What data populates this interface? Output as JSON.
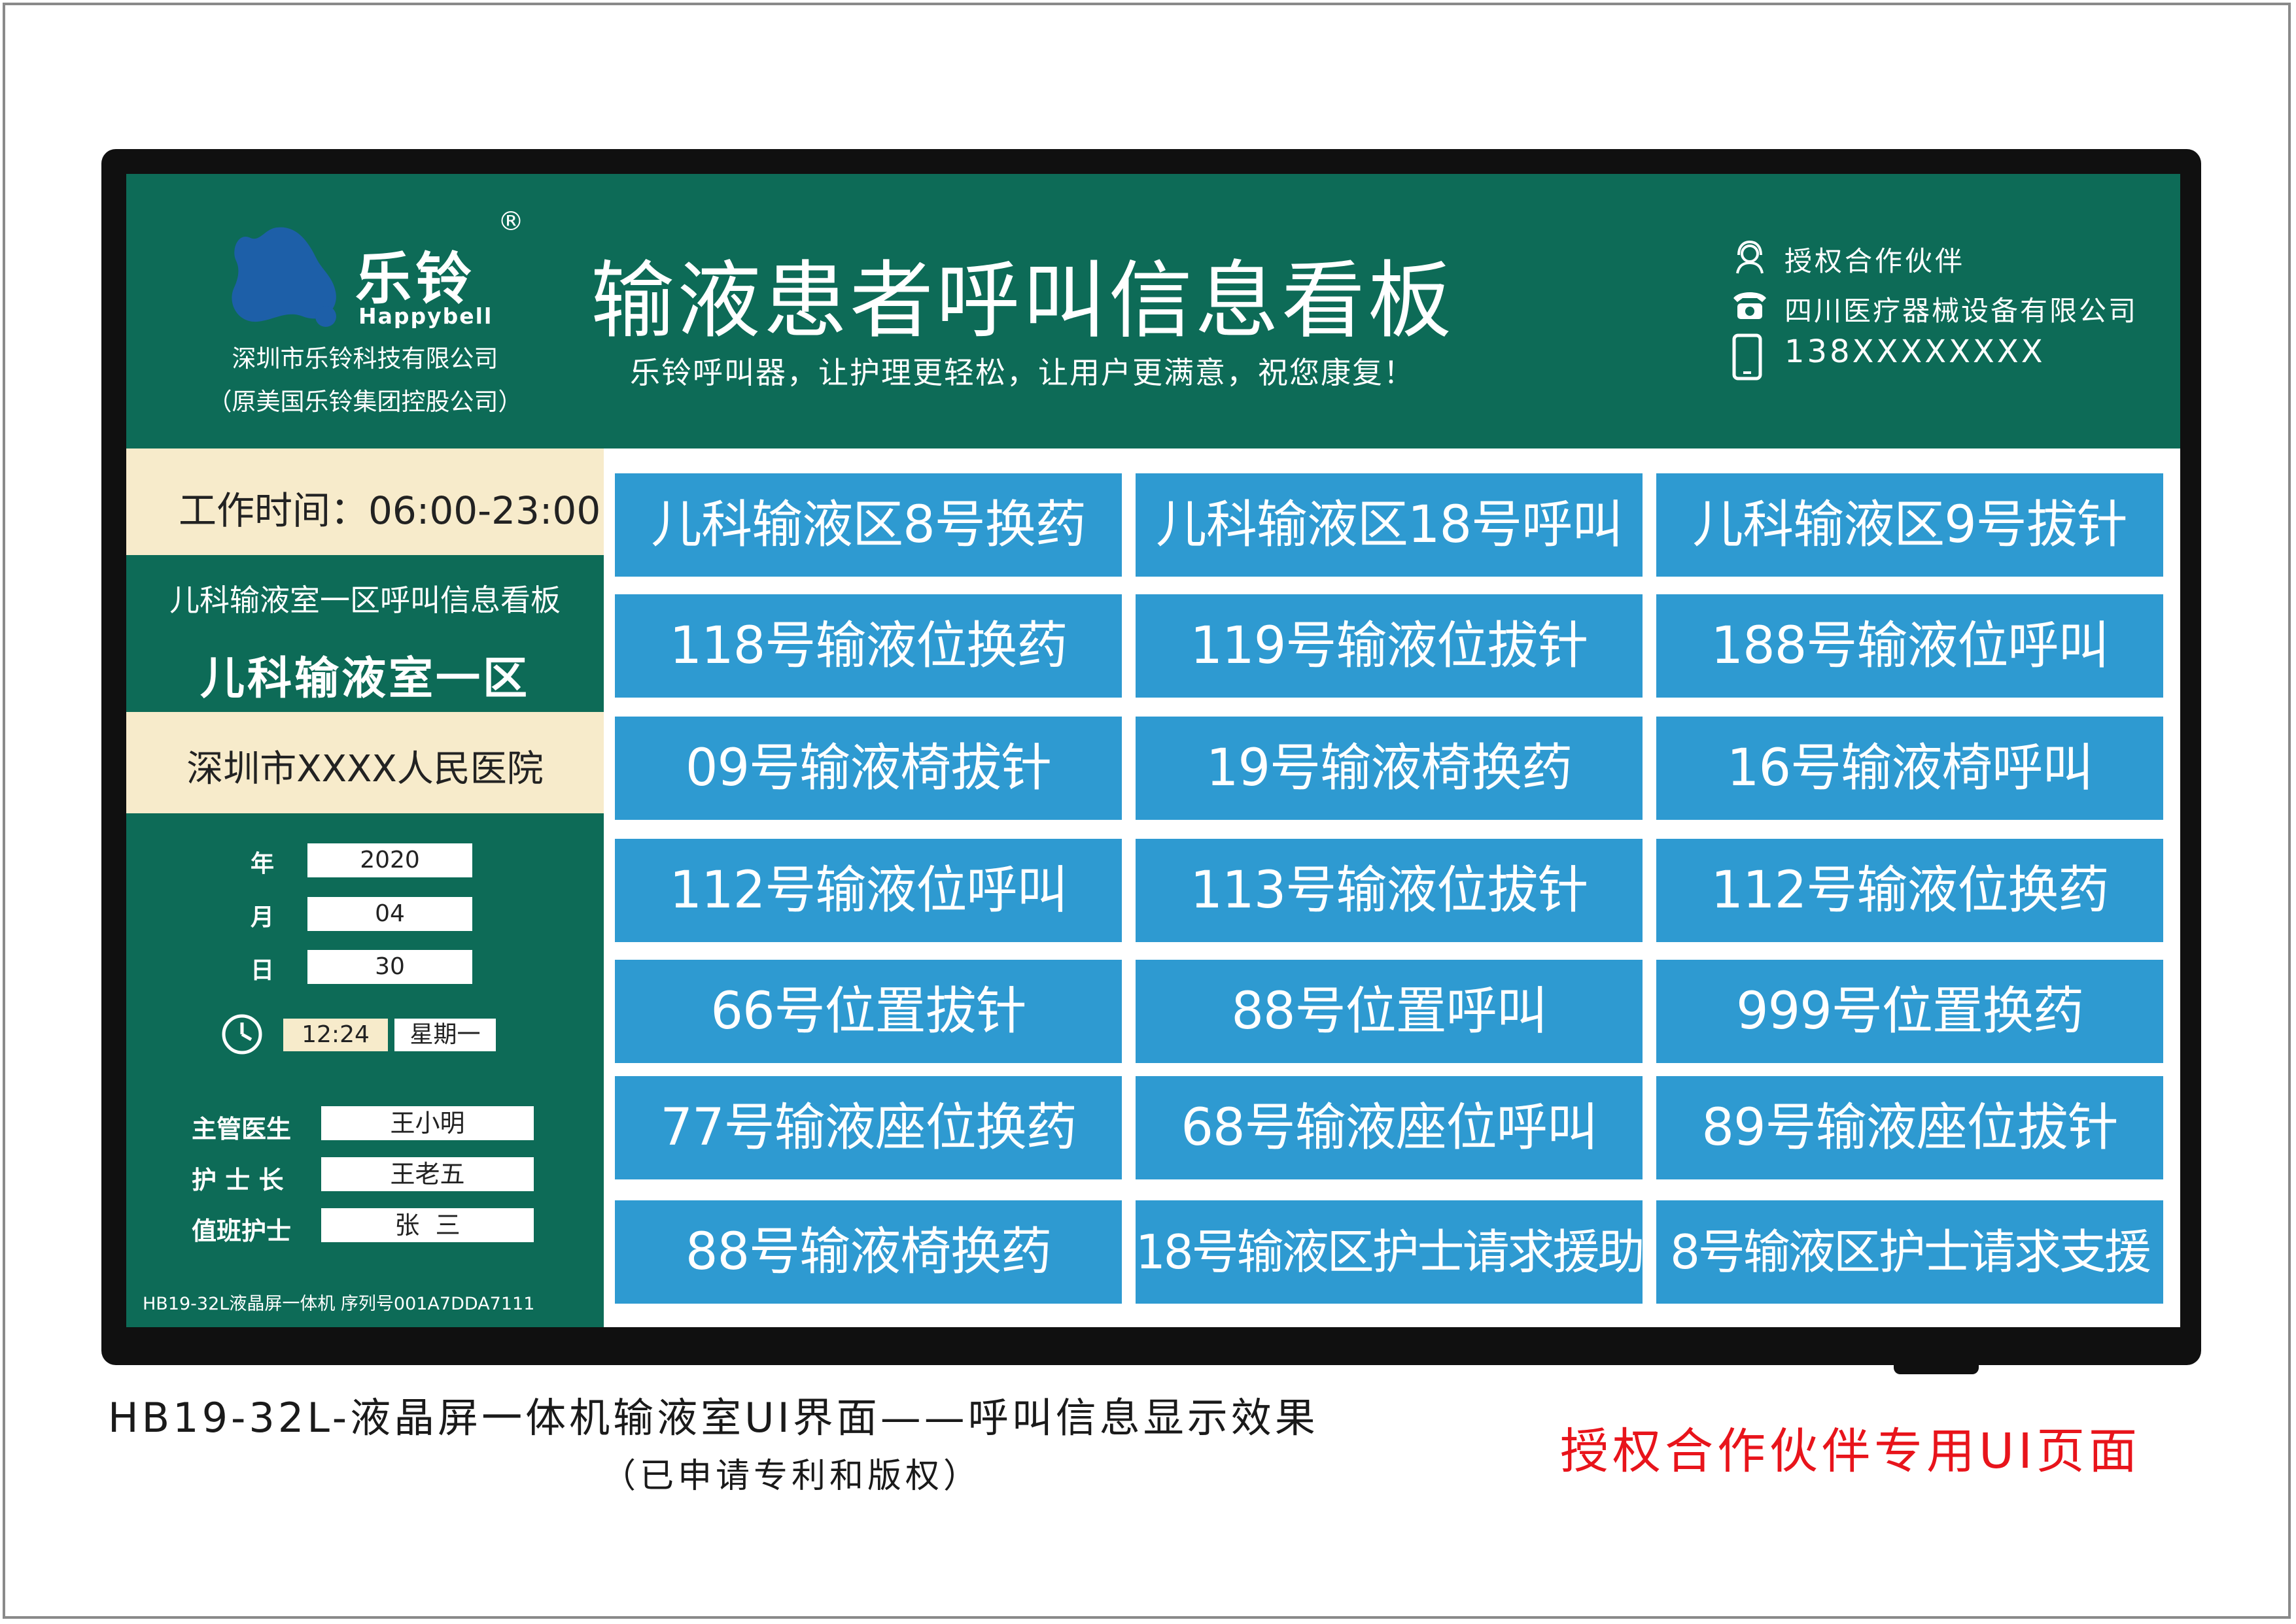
{
  "header": {
    "brand_cn": "乐铃",
    "brand_en": "Happybell",
    "registered_mark": "®",
    "company_line1": "深圳市乐铃科技有限公司",
    "company_line2": "（原美国乐铃集团控股公司）",
    "title": "输液患者呼叫信息看板",
    "slogan": "乐铃呼叫器，让护理更轻松，让用户更满意，祝您康复！",
    "partner_label": "授权合作伙伴",
    "partner_company": "四川医疗器械设备有限公司",
    "phone": "138XXXXXXXX"
  },
  "left": {
    "work_time": "工作时间：06:00-23:00",
    "board_subtitle": "儿科输液室一区呼叫信息看板",
    "board_name": "儿科输液室一区",
    "hospital": "深圳市XXXX人民医院",
    "date": {
      "year_label": "年",
      "year": "2020",
      "month_label": "月",
      "month": "04",
      "day_label": "日",
      "day": "30"
    },
    "time": "12:24",
    "weekday": "星期一",
    "staff": {
      "doctor_label": "主管医生",
      "doctor": "王小明",
      "head_nurse_label": "护 士 长",
      "head_nurse": "王老五",
      "duty_nurse_label": "值班护士",
      "duty_nurse": "张  三"
    },
    "serial": "HB19-32L液晶屏一体机 序列号001A7DDA7111"
  },
  "calls": [
    [
      "儿科输液区8号换药",
      "儿科输液区18号呼叫",
      "儿科输液区9号拔针"
    ],
    [
      "118号输液位换药",
      "119号输液位拔针",
      "188号输液位呼叫"
    ],
    [
      "09号输液椅拔针",
      "19号输液椅换药",
      "16号输液椅呼叫"
    ],
    [
      "112号输液位呼叫",
      "113号输液位拔针",
      "112号输液位换药"
    ],
    [
      "66号位置拔针",
      "88号位置呼叫",
      "999号位置换药"
    ],
    [
      "77号输液座位换药",
      "68号输液座位呼叫",
      "89号输液座位拔针"
    ],
    [
      "88号输液椅换药",
      "18号输液区护士请求援助",
      "8号输液区护士请求支援"
    ]
  ],
  "captions": {
    "main": "HB19-32L-液晶屏一体机输液室UI界面——呼叫信息显示效果",
    "patent": "（已申请专利和版权）",
    "partner_note": "授权合作伙伴专用UI页面"
  },
  "colors": {
    "panel_green": "#0d6b57",
    "cell_blue": "#2e9ad1",
    "cream": "#f7ebcb",
    "bezel": "#101010",
    "caption_red": "#e8141b"
  },
  "icons": [
    "bell-logo-icon",
    "headset-icon",
    "telephone-icon",
    "mobile-phone-icon",
    "clock-icon"
  ]
}
